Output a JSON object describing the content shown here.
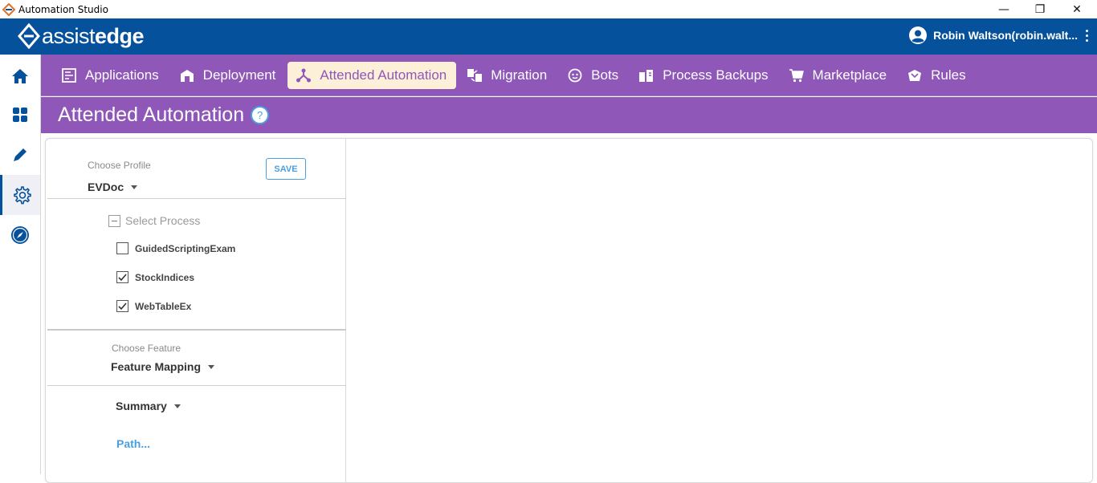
{
  "window": {
    "title": "Automation Studio",
    "controls": {
      "minimize": "—",
      "restore": "❐",
      "close": "✕"
    }
  },
  "brand": {
    "logo_light": "assist",
    "logo_bold": "edge",
    "color": "#06519c"
  },
  "user": {
    "name": "Robin Waltson(robin.walt..."
  },
  "rail": {
    "items": [
      {
        "icon": "home-icon"
      },
      {
        "icon": "dashboard-icon"
      },
      {
        "icon": "pencil-icon"
      },
      {
        "icon": "gear-icon",
        "active": true
      },
      {
        "icon": "compass-icon"
      }
    ]
  },
  "nav": {
    "accent": "#8e57b8",
    "items": [
      {
        "label": "Applications",
        "icon": "applications-icon"
      },
      {
        "label": "Deployment",
        "icon": "deployment-icon"
      },
      {
        "label": "Attended Automation",
        "icon": "attended-automation-icon",
        "active": true
      },
      {
        "label": "Migration",
        "icon": "migration-icon"
      },
      {
        "label": "Bots",
        "icon": "bots-icon"
      },
      {
        "label": "Process Backups",
        "icon": "process-backups-icon"
      },
      {
        "label": "Marketplace",
        "icon": "marketplace-icon"
      },
      {
        "label": "Rules",
        "icon": "rules-icon"
      }
    ]
  },
  "page": {
    "title": "Attended Automation",
    "help": "?"
  },
  "profile": {
    "label": "Choose Profile",
    "value": "EVDoc",
    "save": "SAVE"
  },
  "process": {
    "label": "Select Process",
    "items": [
      {
        "name": "GuidedScriptingExam",
        "checked": false
      },
      {
        "name": "StockIndices",
        "checked": true
      },
      {
        "name": "WebTableEx",
        "checked": true
      }
    ]
  },
  "feature": {
    "label": "Choose Feature",
    "value": "Feature Mapping"
  },
  "summary": {
    "value": "Summary",
    "path_link": "Path..."
  }
}
